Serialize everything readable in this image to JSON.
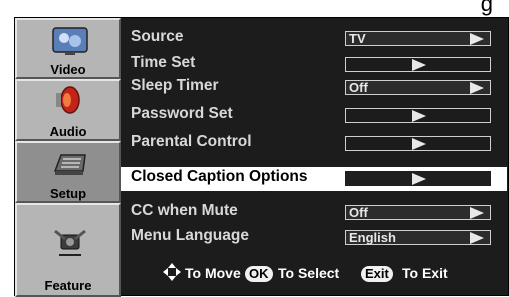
{
  "header_fragment": "g",
  "sidebar": {
    "items": [
      {
        "label": "Video",
        "icon": "video-icon"
      },
      {
        "label": "Audio",
        "icon": "speaker-icon"
      },
      {
        "label": "Setup",
        "icon": "keyboard-icon"
      },
      {
        "label": "Feature",
        "icon": "satellite-icon"
      }
    ]
  },
  "menu": {
    "rows": [
      {
        "label": "Source",
        "value": "TV"
      },
      {
        "label": "Time Set",
        "value": ""
      },
      {
        "label": "Sleep Timer",
        "value": "Off"
      },
      {
        "label": "Password Set",
        "value": ""
      },
      {
        "label": "Parental Control",
        "value": ""
      },
      {
        "label": "Closed Caption Options",
        "value": "",
        "selected": true
      },
      {
        "label": "CC when Mute",
        "value": "Off"
      },
      {
        "label": "Menu Language",
        "value": "English"
      }
    ]
  },
  "hint": {
    "move_text": "To Move",
    "ok_key": "OK",
    "select_text": "To Select",
    "exit_key": "Exit",
    "exit_text": "To Exit"
  },
  "colors": {
    "osd_bg": "#1c1c1c",
    "sidebar_bg": "#b5b5b5",
    "selected_row_bg": "#ffffff"
  }
}
